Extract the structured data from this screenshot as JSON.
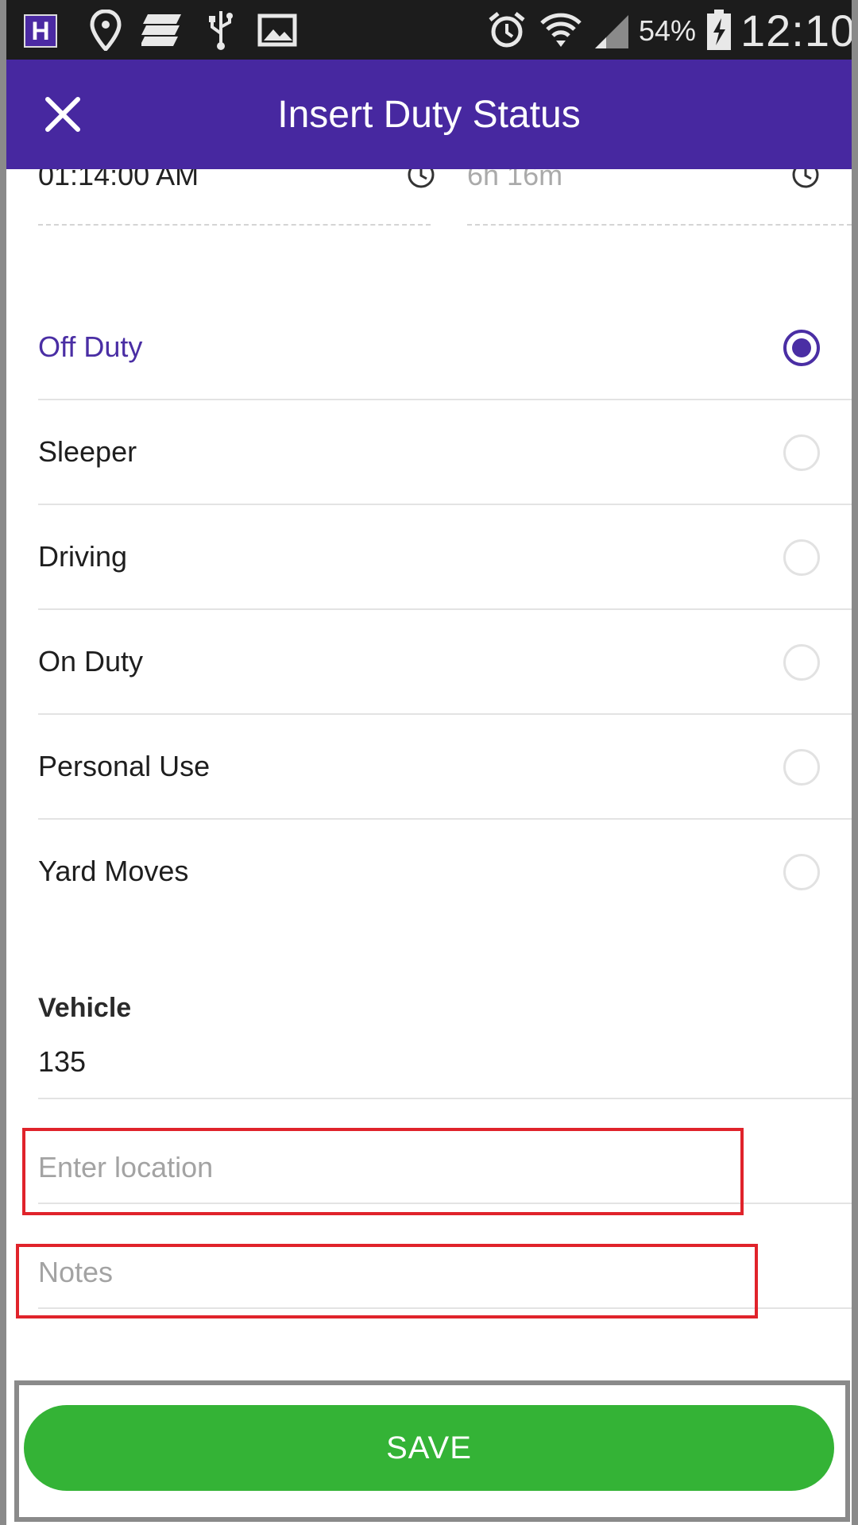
{
  "status_bar": {
    "app_badge": "H",
    "battery": "54%",
    "time": "12:10",
    "icons": [
      "h-app-icon",
      "location-pin-icon",
      "storage-icon",
      "usb-icon",
      "image-icon",
      "alarm-icon",
      "wifi-icon",
      "signal-icon",
      "battery-charging-icon"
    ]
  },
  "header": {
    "title": "Insert Duty Status",
    "close_icon": "close-icon"
  },
  "time_fields": {
    "start_time": "01:14:00 AM",
    "duration": "6h 16m"
  },
  "duty_statuses": {
    "selected": "Off Duty",
    "options": [
      "Off Duty",
      "Sleeper",
      "Driving",
      "On Duty",
      "Personal Use",
      "Yard Moves"
    ]
  },
  "vehicle": {
    "label": "Vehicle",
    "value": "135"
  },
  "location": {
    "placeholder": "Enter location",
    "value": ""
  },
  "notes": {
    "placeholder": "Notes",
    "value": ""
  },
  "actions": {
    "save_label": "SAVE"
  },
  "colors": {
    "app_bar": "#4728a0",
    "accent": "#4a2ea4",
    "save_button": "#34b336",
    "highlight_box": "#e0232b"
  }
}
